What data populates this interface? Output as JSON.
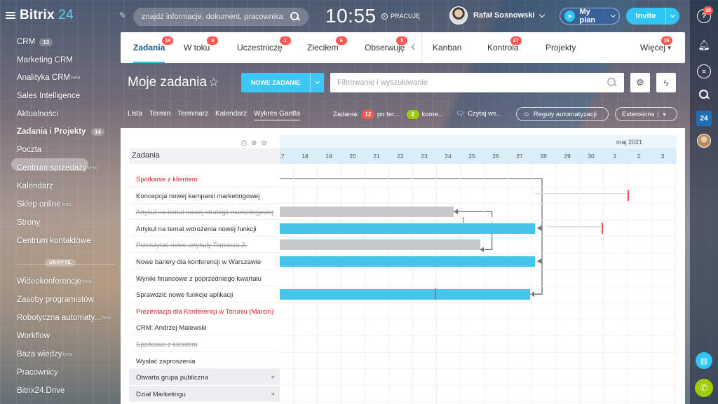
{
  "app": {
    "brand": "Bitrix",
    "brand_num": "24",
    "search_placeholder": "znajdź informacje, dokument, pracownika",
    "clock": "10:55",
    "status": "PRACUJĘ",
    "user_name": "Rafał Sosnowski",
    "my_plan": "My plan",
    "invite": "Invite",
    "notifications": "10"
  },
  "sidebar": {
    "items": [
      {
        "label": "CRM",
        "count": "13"
      },
      {
        "label": "Marketing CRM"
      },
      {
        "label": "Analityka CRM",
        "sup": "beta"
      },
      {
        "label": "Sales Intelligence"
      },
      {
        "label": "Aktualności"
      },
      {
        "label": "Zadania i Projekty",
        "count": "14"
      },
      {
        "label": "Poczta"
      },
      {
        "label": "Centrum sprzedaży",
        "sup": "beta"
      },
      {
        "label": "Kalendarz"
      },
      {
        "label": "Sklep online",
        "sup": "beta"
      },
      {
        "label": "Strony"
      },
      {
        "label": "Centrum kontaktowe"
      },
      {
        "label": "Wideokonferencje",
        "sup": "beta"
      },
      {
        "label": "Zasoby programistów"
      },
      {
        "label": "Robotyczna automaty...",
        "sup": "beta"
      },
      {
        "label": "Workflow"
      },
      {
        "label": "Baza wiedzy",
        "sup": "beta"
      },
      {
        "label": "Pracownicy"
      },
      {
        "label": "Bitrix24.Drive"
      }
    ],
    "hidden_label": "UKRYTE"
  },
  "tabs": {
    "items": [
      {
        "label": "Zadania",
        "badge": "14"
      },
      {
        "label": "W toku",
        "badge": "8"
      },
      {
        "label": "Uczestniczę",
        "badge": "1"
      },
      {
        "label": "Zleciłem",
        "badge": "6"
      },
      {
        "label": "Obserwuję",
        "badge": "5"
      },
      {
        "label": "Kanban"
      },
      {
        "label": "Kontrola",
        "badge": "27"
      },
      {
        "label": "Projekty"
      },
      {
        "label": "Więcej",
        "badge": "29"
      }
    ]
  },
  "toolbar": {
    "title": "Moje zadania",
    "new_task": "NOWE ZADANIE",
    "filter_placeholder": "Filtrowanie i wyszukiwanie"
  },
  "views": {
    "items": [
      "Lista",
      "Termin",
      "Terminarz",
      "Kalendarz",
      "Wykres Gantta"
    ],
    "counters_label": "Zadania:",
    "counter_red": "12",
    "counter_red_label": "po ter...",
    "counter_green": "2",
    "counter_green_label": "kome...",
    "read_all": "Czytaj ws...",
    "automation": "Reguły automatyzacji",
    "extensions": "Extensions"
  },
  "gantt": {
    "column_title": "Zadania",
    "month": "maj 2021",
    "days": [
      "17",
      "18",
      "19",
      "20",
      "21",
      "22",
      "23",
      "24",
      "25",
      "26",
      "27",
      "28",
      "29",
      "30",
      "1",
      "2",
      "3"
    ],
    "rows": [
      {
        "label": "Spotkanie z klientem",
        "style": "red"
      },
      {
        "label": "Koncepcja nowej kampanii marketingowej",
        "style": "normal"
      },
      {
        "label": "Artykuł na temat nowej strategii marketingowej",
        "style": "done"
      },
      {
        "label": "Artykuł na temat wdrożenia nowej funkcji",
        "style": "normal"
      },
      {
        "label": "Przeczytać nowe artykuły Tomasza Z.",
        "style": "done"
      },
      {
        "label": "Nowe banery dla konferencji w Warszawie",
        "style": "normal"
      },
      {
        "label": "Wyniki finansowe z poprzedniego kwartału",
        "style": "normal"
      },
      {
        "label": "Sprawdzić nowe funkcje aplikacji",
        "style": "normal"
      },
      {
        "label": "Prezentacja dla Konferencji w Toruniu (Marcin)",
        "style": "red"
      },
      {
        "label": "CRM: Andrzej Malewski",
        "style": "normal"
      },
      {
        "label": "Spotkanie z klientem",
        "style": "done"
      },
      {
        "label": "Wysłać zaproszenia",
        "style": "normal"
      },
      {
        "label": "Otwarta grupa publiczna",
        "style": "group"
      },
      {
        "label": "Dział Marketingu",
        "style": "group"
      }
    ],
    "bars": [
      {
        "row": 2,
        "start": 0,
        "end": 7.3,
        "color": "grey"
      },
      {
        "row": 3,
        "start": 0,
        "end": 10.7,
        "color": "blue"
      },
      {
        "row": 4,
        "start": 0,
        "end": 8.4,
        "color": "grey"
      },
      {
        "row": 5,
        "start": 0,
        "end": 10.7,
        "color": "blue"
      },
      {
        "row": 7,
        "start": 0,
        "end": 10.5,
        "color": "blue"
      }
    ],
    "deadlines": [
      {
        "row": 1,
        "at": 14.6
      },
      {
        "row": 3,
        "at": 13.5
      },
      {
        "row": 7,
        "at": 6.5
      }
    ],
    "colors": {
      "blue": "#47c4ec",
      "grey": "#c6c9cc",
      "deadline": "#f0525a",
      "accent": "#2fc6f6"
    }
  }
}
